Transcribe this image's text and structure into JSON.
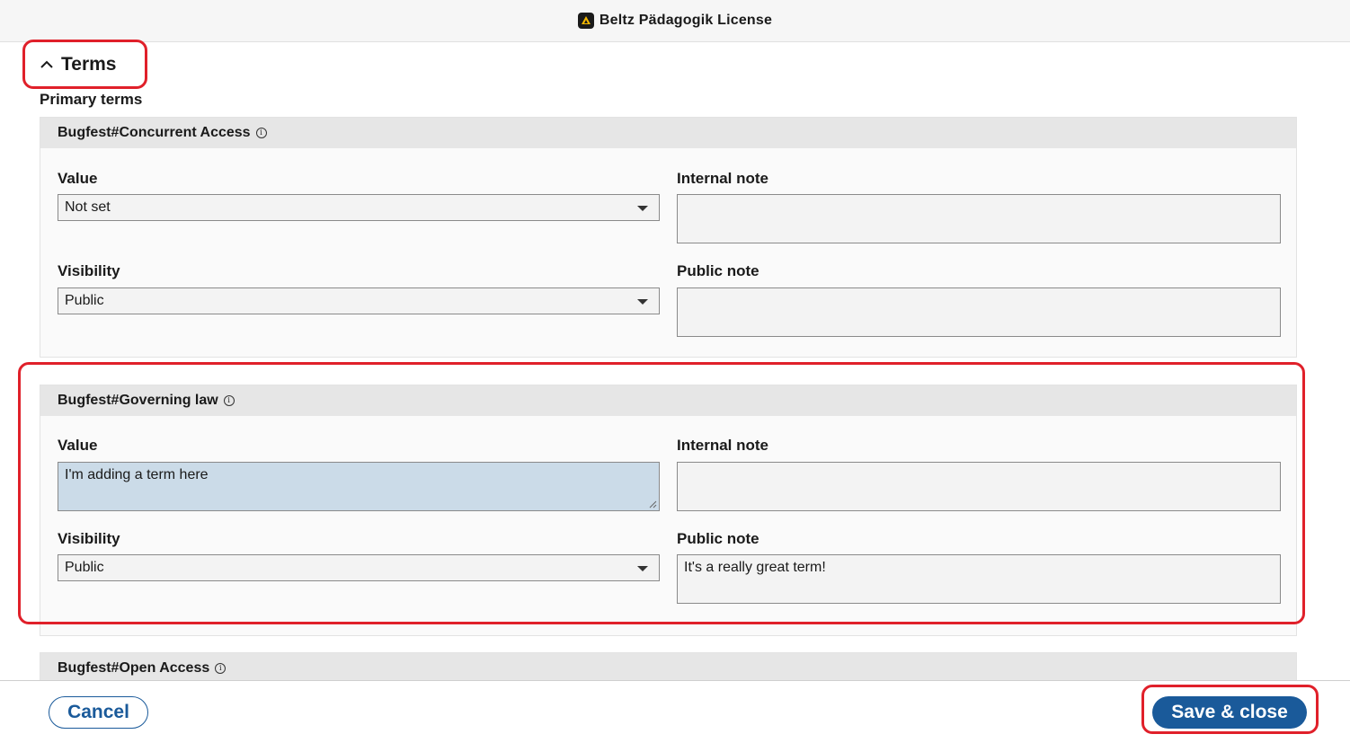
{
  "app": {
    "title": "Beltz Pädagogik License"
  },
  "section": {
    "title": "Terms",
    "subtitle": "Primary terms"
  },
  "terms": [
    {
      "name": "Bugfest#Concurrent Access",
      "value_label": "Value",
      "value": "Not set",
      "internal_note_label": "Internal note",
      "internal_note": "",
      "visibility_label": "Visibility",
      "visibility": "Public",
      "public_note_label": "Public note",
      "public_note": ""
    },
    {
      "name": "Bugfest#Governing law",
      "value_label": "Value",
      "value": "I'm adding a term here",
      "internal_note_label": "Internal note",
      "internal_note": "",
      "visibility_label": "Visibility",
      "visibility": "Public",
      "public_note_label": "Public note",
      "public_note": "It's a really great term!"
    },
    {
      "name": "Bugfest#Open Access"
    }
  ],
  "footer": {
    "cancel": "Cancel",
    "save": "Save & close"
  },
  "colors": {
    "primary": "#1a5a9a",
    "annotation": "#e0202a",
    "active_field": "#cbdbe8"
  }
}
